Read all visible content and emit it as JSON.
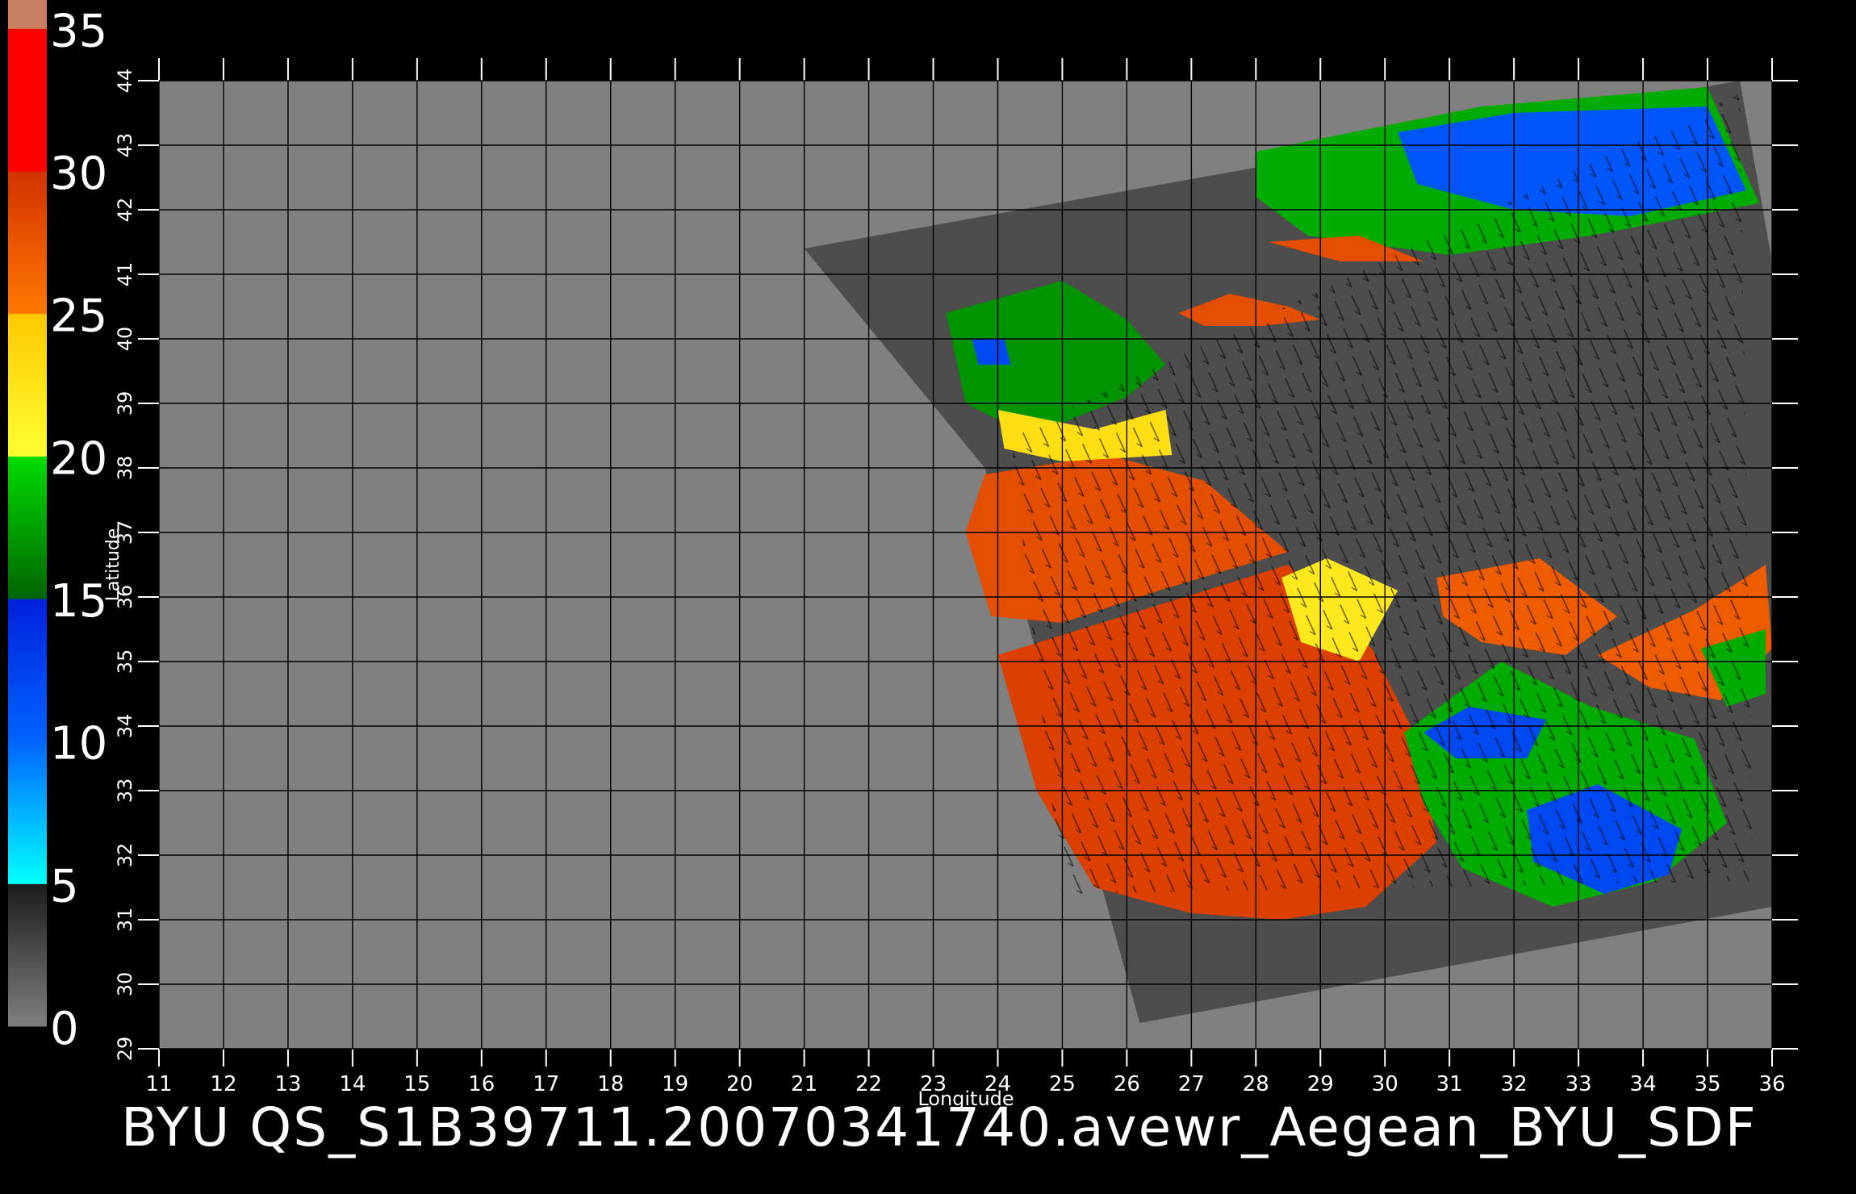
{
  "figure": {
    "title": "BYU  QS_S1B39711.20070341740.avewr_Aegean_BYU_SDF",
    "xlabel": "Longitude",
    "ylabel": "Latitude"
  },
  "colorbar": {
    "ticks": [
      "0",
      "5",
      "10",
      "15",
      "20",
      "25",
      "30",
      "35"
    ],
    "bands": [
      {
        "from": 0,
        "to": 5,
        "colors": [
          "#7f7f7f",
          "#1c1c1c"
        ]
      },
      {
        "from": 5,
        "to": 10,
        "colors": [
          "#00ffff",
          "#0064ff"
        ]
      },
      {
        "from": 10,
        "to": 15,
        "colors": [
          "#0064ff",
          "#0020dc"
        ]
      },
      {
        "from": 15,
        "to": 20,
        "colors": [
          "#006400",
          "#00dc00"
        ]
      },
      {
        "from": 20,
        "to": 25,
        "colors": [
          "#ffff32",
          "#ffc800"
        ]
      },
      {
        "from": 25,
        "to": 30,
        "colors": [
          "#ff7800",
          "#d23200"
        ]
      },
      {
        "from": 30,
        "to": 35,
        "colors": [
          "#ff0000",
          "#ff0000"
        ]
      },
      {
        "from": 35,
        "to": 36,
        "colors": [
          "#c88060",
          "#c88060"
        ]
      }
    ]
  },
  "map": {
    "lon_ticks": [
      "11",
      "12",
      "13",
      "14",
      "15",
      "16",
      "17",
      "18",
      "19",
      "20",
      "21",
      "22",
      "23",
      "24",
      "25",
      "26",
      "27",
      "28",
      "29",
      "30",
      "31",
      "32",
      "33",
      "34",
      "35",
      "36"
    ],
    "lat_ticks": [
      "29",
      "30",
      "31",
      "32",
      "33",
      "34",
      "35",
      "36",
      "37",
      "38",
      "39",
      "40",
      "41",
      "42",
      "43",
      "44"
    ],
    "lon_range": [
      11,
      36
    ],
    "lat_range": [
      29,
      44
    ],
    "grid": true,
    "colors": {
      "background": "#000000",
      "map_fill": "#808080",
      "swath": "#4d4d4d",
      "grid": "#000000",
      "ticks": "#ffffff"
    },
    "swath_lonlat": [
      [
        21,
        41.4
      ],
      [
        35.5,
        44
      ],
      [
        36,
        41.2
      ],
      [
        36,
        31.2
      ],
      [
        26.2,
        29.4
      ],
      [
        23.8,
        38
      ]
    ],
    "wind_regions": [
      {
        "level": 28,
        "poly": [
          [
            23.8,
            37.9
          ],
          [
            25.7,
            38.2
          ],
          [
            27.2,
            37.8
          ],
          [
            28.5,
            36.7
          ],
          [
            27.5,
            36.4
          ],
          [
            26.5,
            36.1
          ],
          [
            25,
            35.6
          ],
          [
            23.9,
            35.7
          ],
          [
            23.5,
            37
          ]
        ]
      },
      {
        "level": 29,
        "poly": [
          [
            24,
            35.1
          ],
          [
            28.5,
            36.5
          ],
          [
            29.8,
            35.2
          ],
          [
            30.5,
            33.8
          ],
          [
            30.8,
            32.2
          ],
          [
            29.7,
            31.2
          ],
          [
            28.4,
            31
          ],
          [
            27,
            31.1
          ],
          [
            25.5,
            31.5
          ],
          [
            24.6,
            33
          ]
        ]
      },
      {
        "level": 22,
        "poly": [
          [
            28.4,
            36.3
          ],
          [
            29.1,
            36.6
          ],
          [
            30.2,
            36.1
          ],
          [
            29.6,
            35
          ],
          [
            28.7,
            35.3
          ]
        ]
      },
      {
        "level": 18,
        "poly": [
          [
            30.3,
            33.9
          ],
          [
            31.8,
            35
          ],
          [
            33.2,
            34.3
          ],
          [
            34.8,
            33.8
          ],
          [
            35.3,
            32.5
          ],
          [
            34.2,
            31.6
          ],
          [
            32.6,
            31.2
          ],
          [
            31.2,
            31.8
          ],
          [
            30.6,
            32.8
          ]
        ]
      },
      {
        "level": 12,
        "poly": [
          [
            32.2,
            32.7
          ],
          [
            33.3,
            33.1
          ],
          [
            34.6,
            32.4
          ],
          [
            34.4,
            31.7
          ],
          [
            33.4,
            31.4
          ],
          [
            32.3,
            31.9
          ]
        ]
      },
      {
        "level": 12,
        "poly": [
          [
            30.6,
            33.9
          ],
          [
            31.3,
            34.3
          ],
          [
            32.5,
            34.1
          ],
          [
            32.2,
            33.5
          ],
          [
            31.1,
            33.5
          ]
        ]
      },
      {
        "level": 27,
        "poly": [
          [
            30.8,
            36.3
          ],
          [
            32.4,
            36.6
          ],
          [
            33.6,
            35.7
          ],
          [
            32.8,
            35.1
          ],
          [
            31.5,
            35.3
          ],
          [
            30.9,
            35.7
          ]
        ]
      },
      {
        "level": 27,
        "poly": [
          [
            33.3,
            35.1
          ],
          [
            34.8,
            35.8
          ],
          [
            35.9,
            36.5
          ],
          [
            36,
            35.2
          ],
          [
            35.2,
            34.4
          ],
          [
            34.1,
            34.6
          ]
        ]
      },
      {
        "level": 18,
        "poly": [
          [
            34.9,
            35.2
          ],
          [
            35.9,
            35.5
          ],
          [
            35.9,
            34.5
          ],
          [
            35.3,
            34.3
          ]
        ]
      },
      {
        "level": 17,
        "poly": [
          [
            23.2,
            40.4
          ],
          [
            25,
            40.9
          ],
          [
            26,
            40.3
          ],
          [
            26.6,
            39.6
          ],
          [
            26,
            39.1
          ],
          [
            24.5,
            38.5
          ],
          [
            23.5,
            39
          ]
        ]
      },
      {
        "level": 12,
        "poly": [
          [
            23.6,
            40
          ],
          [
            24.1,
            40
          ],
          [
            24.2,
            39.6
          ],
          [
            23.7,
            39.6
          ]
        ]
      },
      {
        "level": 23,
        "poly": [
          [
            24,
            38.9
          ],
          [
            25.5,
            38.6
          ],
          [
            26.6,
            38.9
          ],
          [
            26.7,
            38.2
          ],
          [
            25,
            38.1
          ],
          [
            24.1,
            38.3
          ]
        ]
      },
      {
        "level": 28,
        "poly": [
          [
            26.8,
            40.4
          ],
          [
            27.6,
            40.7
          ],
          [
            28.5,
            40.5
          ],
          [
            29,
            40.3
          ],
          [
            28.1,
            40.2
          ],
          [
            27.2,
            40.2
          ]
        ]
      },
      {
        "level": 18,
        "poly": [
          [
            28,
            42.9
          ],
          [
            31.5,
            43.6
          ],
          [
            35,
            43.9
          ],
          [
            35.8,
            42.1
          ],
          [
            33.2,
            41.6
          ],
          [
            31,
            41.3
          ],
          [
            28.8,
            41.6
          ],
          [
            28,
            42.2
          ]
        ]
      },
      {
        "level": 11,
        "poly": [
          [
            30.2,
            43.2
          ],
          [
            32,
            43.5
          ],
          [
            35,
            43.6
          ],
          [
            35.6,
            42.3
          ],
          [
            33.8,
            41.9
          ],
          [
            32,
            42
          ],
          [
            30.5,
            42.4
          ]
        ]
      },
      {
        "level": 28,
        "poly": [
          [
            28.2,
            41.5
          ],
          [
            29.3,
            41.2
          ],
          [
            30.6,
            41.2
          ],
          [
            29.6,
            41.6
          ]
        ]
      }
    ],
    "vector_region": [
      [
        24.2,
        38.5
      ],
      [
        35.5,
        43.8
      ],
      [
        35.7,
        31.6
      ],
      [
        25,
        31.4
      ]
    ]
  }
}
